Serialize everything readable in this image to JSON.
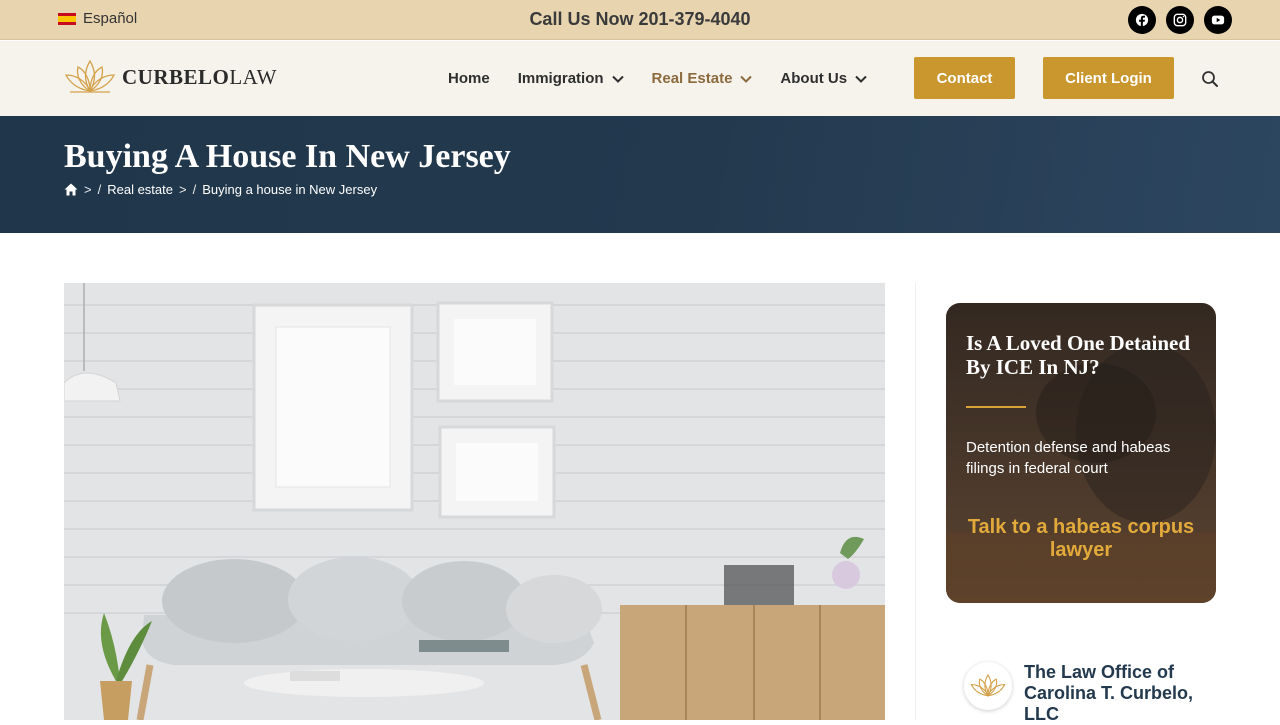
{
  "topbar": {
    "language": "Español",
    "call": "Call Us Now 201-379-4040",
    "socials": [
      "facebook-icon",
      "instagram-icon",
      "youtube-icon"
    ]
  },
  "header": {
    "logo_bold": "CURBELO",
    "logo_light": "LAW",
    "nav": [
      {
        "label": "Home",
        "dropdown": false
      },
      {
        "label": "Immigration",
        "dropdown": true
      },
      {
        "label": "Real Estate",
        "dropdown": true,
        "active": true
      },
      {
        "label": "About Us",
        "dropdown": true
      }
    ],
    "contact_button": "Contact",
    "login_button": "Client Login"
  },
  "title_band": {
    "title": "Buying A House In New Jersey",
    "breadcrumbs": [
      "Real estate",
      "Buying a house in New Jersey"
    ]
  },
  "sidebar": {
    "ad": {
      "title": "Is A Loved One Detained By ICE In NJ?",
      "subtitle": "Detention defense and habeas filings in federal court",
      "cta": "Talk to a habeas corpus lawyer"
    },
    "firm_name": "The Law Office of Carolina T. Curbelo, LLC"
  },
  "colors": {
    "topbar": "#e8d5b0",
    "accent": "#c9972e",
    "navy": "#23394e",
    "active_nav": "#8b6a3e"
  }
}
